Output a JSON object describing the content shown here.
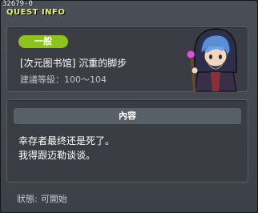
{
  "window": {
    "quest_id": "32679-0",
    "title": "QUEST INFO"
  },
  "quest": {
    "category_badge": "一般",
    "name": "[次元图书馆] 沉重的脚步",
    "level_range": "建議等級：100～104"
  },
  "content": {
    "header": "內容",
    "lines": [
      "幸存者最终还是死了。",
      "我得跟迈勒谈谈。"
    ]
  },
  "status": {
    "label": "狀態:",
    "value": "可開始"
  },
  "colors": {
    "badge": "#8dc21f",
    "title": "#e8f078"
  },
  "icons": {
    "avatar": "npc-portrait"
  }
}
